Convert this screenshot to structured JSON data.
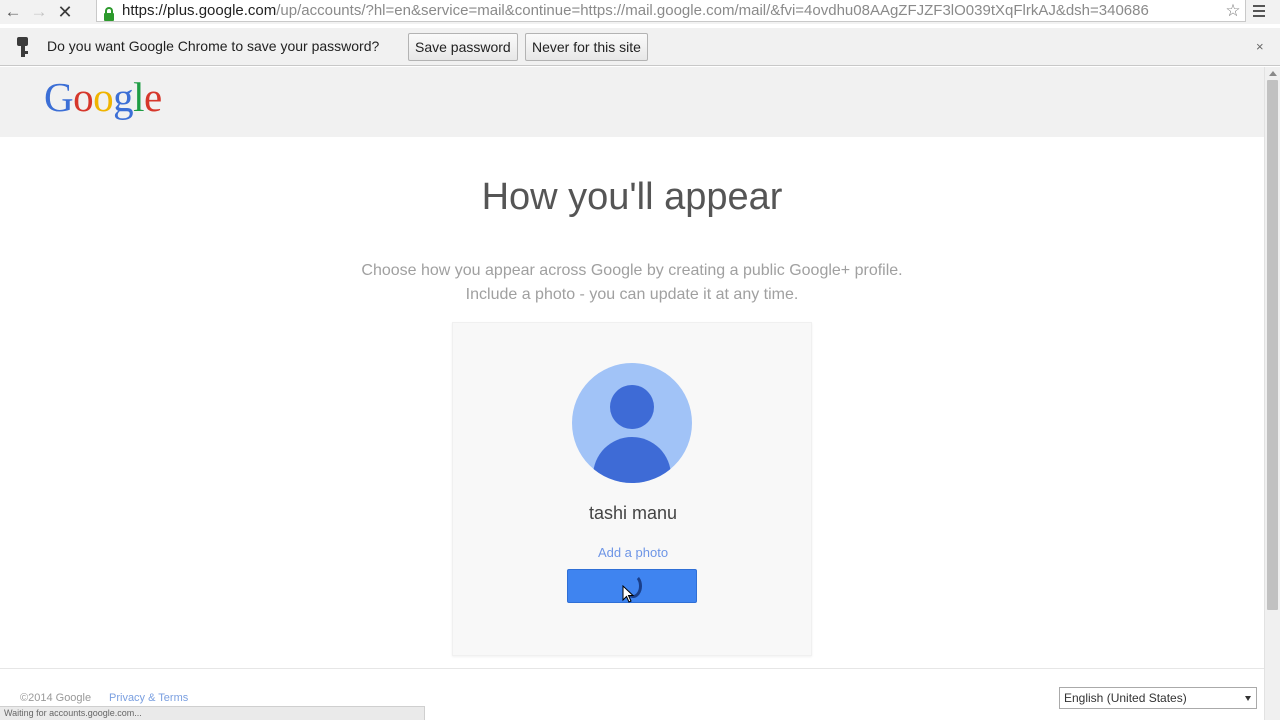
{
  "browser": {
    "url_host": "https://plus.google.com",
    "url_rest": "/up/accounts/?hl=en&service=mail&continue=https://mail.google.com/mail/&fvi=4ovdhu08AAgZFJZF3lO039tXqFlrkAJ&dsh=340686",
    "back_icon": "back-arrow-icon",
    "forward_icon": "forward-arrow-icon",
    "stop_icon": "stop-icon",
    "star_icon": "star-icon",
    "menu_icon": "hamburger-menu-icon"
  },
  "infobar": {
    "message": "Do you want Google Chrome to save your password?",
    "save_label": "Save password",
    "never_label": "Never for this site",
    "close_label": "×",
    "key_icon": "key-icon"
  },
  "logo": {
    "letters": [
      "G",
      "o",
      "o",
      "g",
      "l",
      "e"
    ],
    "colors": [
      "#3c6fd6",
      "#d6372b",
      "#f0b400",
      "#3c6fd6",
      "#1f9d45",
      "#d6372b"
    ]
  },
  "main": {
    "title": "How you'll appear",
    "subtitle_line1": "Choose how you appear across Google by creating a public Google+ profile.",
    "subtitle_line2": "Include a photo - you can update it at any time."
  },
  "card": {
    "name": "tashi manu",
    "add_photo": "Add a photo",
    "avatar_icon": "default-avatar-icon",
    "accent_color": "#3f84f0"
  },
  "footer": {
    "copyright": "©2014 Google",
    "privacy_terms": "Privacy & Terms",
    "language": "English (United States)"
  },
  "status": {
    "text": "Waiting for accounts.google.com..."
  }
}
